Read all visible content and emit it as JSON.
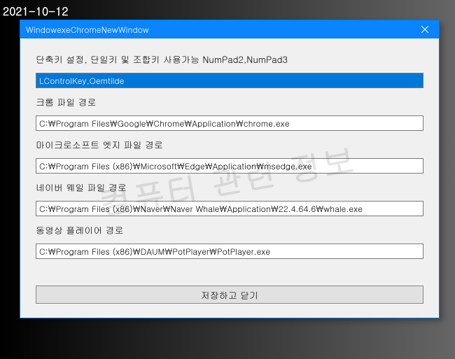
{
  "date": "2021-10-12",
  "watermark": "컴퓨터 관련 정보",
  "window": {
    "title": "WindowexeChromeNewWindow"
  },
  "labels": {
    "shortcut": "단축키 설정, 단일키 및 조합키 사용가능 NumPad2,NumPad3",
    "chrome": "크롬 파일 경로",
    "edge": "마이크로소프트 엣지 파일 경로",
    "whale": "네이버 웨일 파일 경로",
    "player": "동영상 플레이어 경로"
  },
  "fields": {
    "shortcut": "LControlKey,Oemtilde",
    "chrome": "C:₩Program Files₩Google₩Chrome₩Application₩chrome.exe",
    "edge": "C:₩Program Files (x86)₩Microsoft₩Edge₩Application₩msedge.exe",
    "whale": "C:₩Program Files (x86)₩Naver₩Naver Whale₩Application₩22.4.64.6₩whale.exe",
    "player": "C:₩Program Files (x86)₩DAUM₩PotPlayer₩PotPlayer.exe"
  },
  "buttons": {
    "save": "저장하고 닫기"
  }
}
